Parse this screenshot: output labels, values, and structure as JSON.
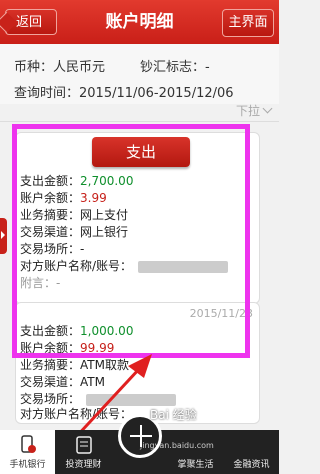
{
  "header": {
    "back_label": "返回",
    "title": "账户明细",
    "home_label": "主界面"
  },
  "info": {
    "currency": "币种：人民币元",
    "cash_flag": "钞汇标志：-",
    "query_period": "查询时间：2015/11/06-2015/12/06"
  },
  "pull_label": "下拉",
  "records": [
    {
      "type_button": "支出",
      "amount_label": "支出金额：",
      "amount": "2,700.00",
      "balance_label": "账户余额：",
      "balance": "3.99",
      "summary": "业务摘要：网上支付",
      "channel": "交易渠道：网上银行",
      "place": "交易场所：-",
      "counterparty": "对方账户名称/账号：",
      "note": "附言：-"
    },
    {
      "date": "2015/11/23",
      "amount_label": "支出金额：",
      "amount": "1,000.00",
      "balance_label": "账户余额：",
      "balance": "99.99",
      "summary": "业务摘要：ATM取款",
      "channel": "交易渠道：ATM",
      "place": "交易场所：",
      "counterparty": "对方账户名称/账号："
    }
  ],
  "tabbar": [
    {
      "label": "手机银行",
      "icon": "phone-bank-icon"
    },
    {
      "label": "投资理财",
      "icon": "calculator-icon"
    },
    {
      "label": "",
      "icon": "plus-icon"
    },
    {
      "label": "掌聚生活",
      "icon": "life-icon"
    },
    {
      "label": "金融资讯",
      "icon": "news-icon"
    }
  ],
  "watermark": {
    "brand": "Bai 经验",
    "url": "jingyan.baidu.com"
  },
  "colors": {
    "header_red": "#c8221a",
    "highlight": "#ee33ee",
    "amount_green": "#0f8f2c",
    "balance_red": "#c6201a"
  }
}
